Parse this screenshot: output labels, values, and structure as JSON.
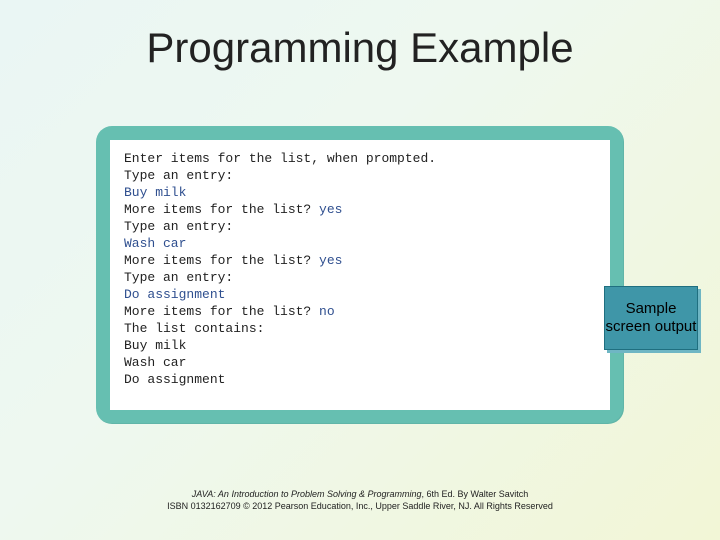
{
  "slide": {
    "title": "Programming Example"
  },
  "console": {
    "lines": [
      {
        "text": "Enter items for the list, when prompted.",
        "input": false
      },
      {
        "text": "Type an entry:",
        "input": false
      },
      {
        "text": "Buy milk",
        "input": true
      },
      {
        "text": "More items for the list? ",
        "input": false,
        "trailing_input": "yes"
      },
      {
        "text": "Type an entry:",
        "input": false
      },
      {
        "text": "Wash car",
        "input": true
      },
      {
        "text": "More items for the list? ",
        "input": false,
        "trailing_input": "yes"
      },
      {
        "text": "Type an entry:",
        "input": false
      },
      {
        "text": "Do assignment",
        "input": true
      },
      {
        "text": "More items for the list? ",
        "input": false,
        "trailing_input": "no"
      },
      {
        "text": "The list contains:",
        "input": false
      },
      {
        "text": "Buy milk",
        "input": false
      },
      {
        "text": "Wash car",
        "input": false
      },
      {
        "text": "Do assignment",
        "input": false
      }
    ]
  },
  "callout": {
    "label": "Sample screen output"
  },
  "footer": {
    "line1_title": "JAVA: An Introduction to Problem Solving & Programming",
    "line1_rest": ", 6th Ed. By Walter Savitch",
    "line2": "ISBN 0132162709 © 2012 Pearson Education, Inc., Upper Saddle River, NJ. All Rights Reserved"
  }
}
